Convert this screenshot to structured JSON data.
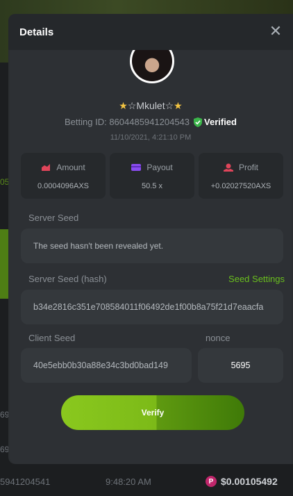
{
  "background": {
    "left_labels": [
      "05",
      "69",
      "69"
    ],
    "row": {
      "id_tail": "5941204541",
      "time": "9:48:20 AM",
      "amount": "$0.00105492"
    }
  },
  "modal": {
    "title": "Details",
    "close_icon": "close-icon"
  },
  "player": {
    "username": "Mkulet",
    "star_left": "★",
    "star_hollow": "☆",
    "star_right": "★",
    "betting_id_label": "Betting ID: 8604485941204543",
    "verified_label": "Verified",
    "date": "11/10/2021, 4:21:10 PM"
  },
  "stats": [
    {
      "label": "Amount",
      "value": "0.0004096AXS",
      "icon": "amount-icon",
      "color": "#e0455a"
    },
    {
      "label": "Payout",
      "value": "50.5 x",
      "icon": "payout-icon",
      "color": "#8a4cf0"
    },
    {
      "label": "Profit",
      "value": "+0.02027520AXS",
      "icon": "profit-icon",
      "color": "#e0455a"
    }
  ],
  "server_seed": {
    "label": "Server Seed",
    "value": "The seed hasn't been revealed yet."
  },
  "server_seed_hash": {
    "label": "Server Seed (hash)",
    "value": "b34e2816c351e708584011f06492de1f00b8a75f21d7eaacfa"
  },
  "seed_settings_label": "Seed Settings",
  "client_seed": {
    "label": "Client Seed",
    "value": "40e5ebb0b30a88e34c3bd0bad149"
  },
  "nonce": {
    "label": "nonce",
    "value": "5695"
  },
  "verify_label": "Verify",
  "colors": {
    "accent": "#6abf1e",
    "button": "#7cba18",
    "panel": "#2d3034"
  }
}
